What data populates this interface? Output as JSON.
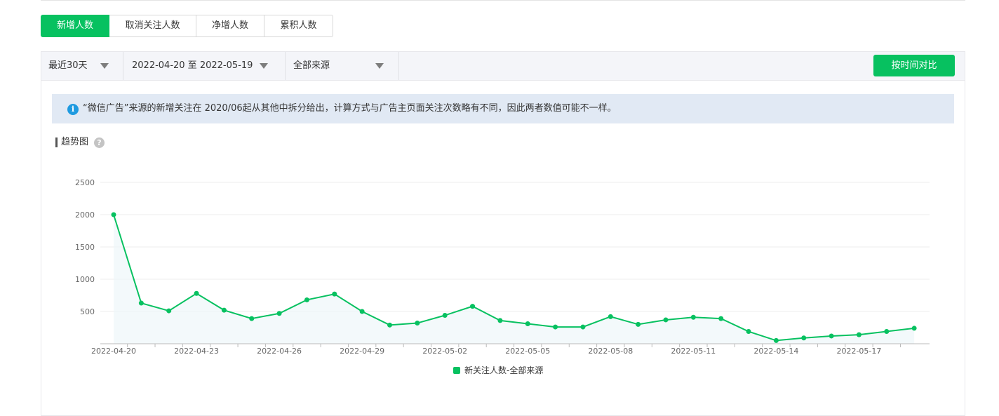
{
  "tabs": [
    {
      "label": "新增人数",
      "active": true
    },
    {
      "label": "取消关注人数",
      "active": false
    },
    {
      "label": "净增人数",
      "active": false
    },
    {
      "label": "累积人数",
      "active": false
    }
  ],
  "filters": {
    "period": "最近30天",
    "date_range": "2022-04-20 至 2022-05-19",
    "source": "全部来源",
    "compare_button": "按时间对比"
  },
  "notice": {
    "icon": "info-icon",
    "text": "“微信广告”来源的新增关注在 2020/06起从其他中拆分给出，计算方式与广告主页面关注次数略有不同，因此两者数值可能不一样。"
  },
  "trend": {
    "title": "趋势图",
    "help": "?"
  },
  "colors": {
    "accent": "#07c160",
    "notice_bg": "#e1e9f4",
    "info": "#1e9ae0"
  },
  "chart_data": {
    "type": "area",
    "title": "",
    "xlabel": "",
    "ylabel": "",
    "ylim": [
      0,
      2500
    ],
    "y_ticks": [
      500,
      1000,
      1500,
      2000,
      2500
    ],
    "x": [
      "2022-04-20",
      "2022-04-21",
      "2022-04-22",
      "2022-04-23",
      "2022-04-24",
      "2022-04-25",
      "2022-04-26",
      "2022-04-27",
      "2022-04-28",
      "2022-04-29",
      "2022-04-30",
      "2022-05-01",
      "2022-05-02",
      "2022-05-03",
      "2022-05-04",
      "2022-05-05",
      "2022-05-06",
      "2022-05-07",
      "2022-05-08",
      "2022-05-09",
      "2022-05-10",
      "2022-05-11",
      "2022-05-12",
      "2022-05-13",
      "2022-05-14",
      "2022-05-15",
      "2022-05-16",
      "2022-05-17",
      "2022-05-18",
      "2022-05-19"
    ],
    "x_tick_labels": [
      "2022-04-20",
      "2022-04-23",
      "2022-04-26",
      "2022-04-29",
      "2022-05-02",
      "2022-05-05",
      "2022-05-08",
      "2022-05-11",
      "2022-05-14",
      "2022-05-17"
    ],
    "series": [
      {
        "name": "新关注人数-全部来源",
        "color": "#07c160",
        "values": [
          2000,
          630,
          510,
          780,
          520,
          390,
          470,
          680,
          770,
          500,
          290,
          320,
          440,
          580,
          360,
          310,
          260,
          260,
          420,
          300,
          370,
          410,
          390,
          190,
          50,
          90,
          120,
          140,
          190,
          240
        ]
      }
    ],
    "grid": true,
    "legend": "bottom-center"
  }
}
